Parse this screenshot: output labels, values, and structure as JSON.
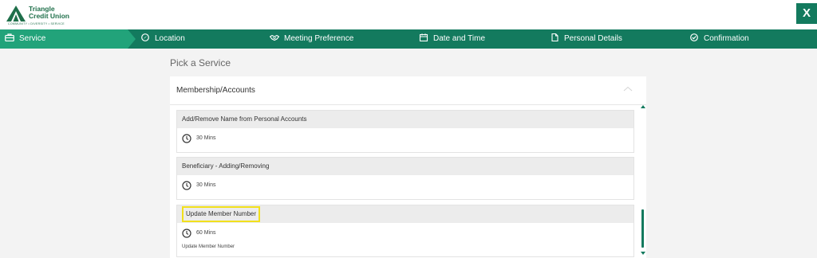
{
  "header": {
    "logo_name_line1": "Triangle",
    "logo_name_line2": "Credit Union",
    "logo_tagline": "COMMUNITY • DIVERSITY • SERVICE",
    "close_label": "X"
  },
  "steps": [
    {
      "label": "Service",
      "icon": "briefcase-icon",
      "active": true
    },
    {
      "label": "Location",
      "icon": "compass-icon",
      "active": false
    },
    {
      "label": "Meeting Preference",
      "icon": "handshake-icon",
      "active": false
    },
    {
      "label": "Date and Time",
      "icon": "calendar-icon",
      "active": false
    },
    {
      "label": "Personal Details",
      "icon": "document-icon",
      "active": false
    },
    {
      "label": "Confirmation",
      "icon": "check-circle-icon",
      "active": false
    }
  ],
  "main": {
    "heading": "Pick a Service",
    "category": "Membership/Accounts",
    "services": [
      {
        "title": "Add/Remove Name from Personal Accounts",
        "duration": "30 Mins",
        "description": ""
      },
      {
        "title": "Beneficiary - Adding/Removing",
        "duration": "30 Mins",
        "description": ""
      },
      {
        "title": "Update Member Number",
        "duration": "60 Mins",
        "description": "Update Member Number"
      }
    ]
  },
  "colors": {
    "brand_green": "#137a5e",
    "active_step": "#22a37a",
    "highlight": "#f2e01c"
  }
}
